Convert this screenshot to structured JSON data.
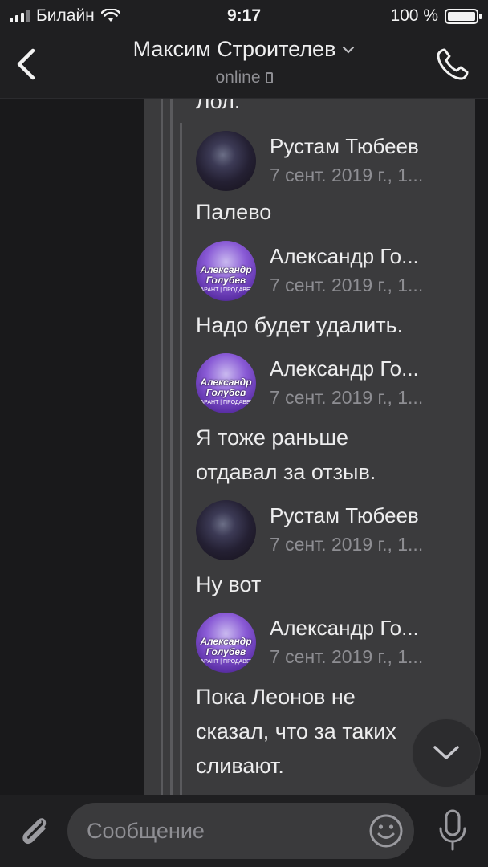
{
  "status_bar": {
    "carrier": "Билайн",
    "time": "9:17",
    "battery": "100 %"
  },
  "header": {
    "title": "Максим Строителев",
    "status": "online",
    "icons": [
      "back-icon",
      "chevron-down-icon",
      "mobile-device-icon",
      "phone-icon"
    ]
  },
  "chat": {
    "top_text": "Лол.",
    "messages": [
      {
        "sender": "Рустам Тюбеев",
        "date": "7 сент. 2019 г., 1...",
        "avatar": "dark",
        "lines": [
          "Палево"
        ]
      },
      {
        "sender": "Александр Го...",
        "date": "7 сент. 2019 г., 1...",
        "avatar": "purple",
        "lines": [
          "Надо будет удалить."
        ]
      },
      {
        "sender": "Александр Го...",
        "date": "7 сент. 2019 г., 1...",
        "avatar": "purple",
        "lines": [
          "Я тоже раньше",
          "отдавал за отзыв."
        ]
      },
      {
        "sender": "Рустам Тюбеев",
        "date": "7 сент. 2019 г., 1...",
        "avatar": "dark",
        "lines": [
          "Ну вот"
        ]
      },
      {
        "sender": "Александр Го...",
        "date": "7 сент. 2019 г., 1...",
        "avatar": "purple",
        "lines": [
          "Пока Леонов не",
          "сказал, что за таких",
          "сливают."
        ]
      }
    ],
    "avatar_caption": {
      "line1": "Александр",
      "line2": "Голубев",
      "sub": "ГАРАНТ | ПРОДАВЕЦ"
    }
  },
  "input": {
    "placeholder": "Сообщение",
    "icons": [
      "paperclip-icon",
      "emoji-icon",
      "microphone-icon"
    ]
  },
  "colors": {
    "background": "#19191b",
    "bubble": "#3b3b3d",
    "bar": "#1f1f21",
    "secondary_text": "#8e8e93"
  }
}
